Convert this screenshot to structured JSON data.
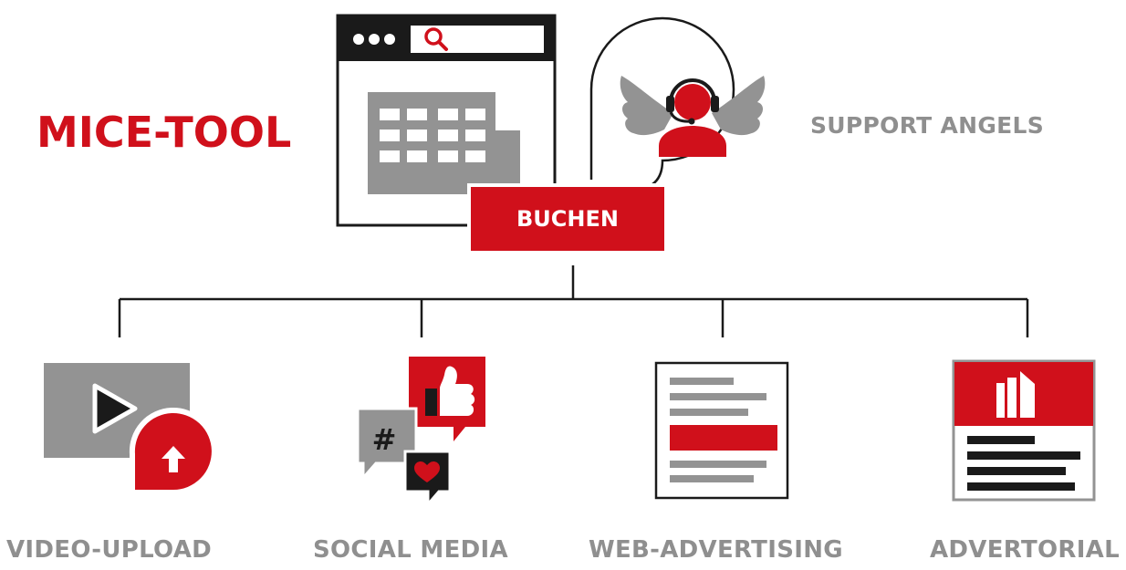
{
  "main_title": "MICE-TOOL",
  "support_label": "SUPPORT ANGELS",
  "book_button": "BUCHEN",
  "social_hashtag": "#",
  "branches": [
    {
      "label": "VIDEO-UPLOAD",
      "icon": "video-upload-icon"
    },
    {
      "label": "SOCIAL MEDIA",
      "icon": "social-media-icon"
    },
    {
      "label": "WEB-ADVERTISING",
      "icon": "web-advertising-icon"
    },
    {
      "label": "ADVERTORIAL",
      "icon": "advertorial-icon"
    }
  ],
  "colors": {
    "accent": "#d0101b",
    "gray": "#8f8f8f",
    "dark": "#1a1a1a"
  }
}
